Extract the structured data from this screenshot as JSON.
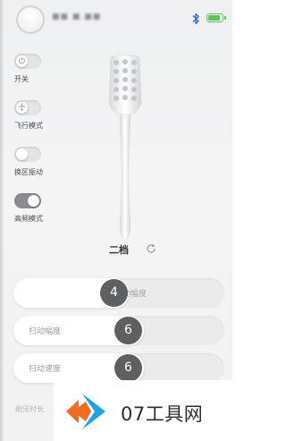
{
  "header": {
    "username": "■■ ■.■■",
    "bluetooth_icon": "bluetooth-icon",
    "battery_level": 0.9,
    "battery_color": "#5cc25a"
  },
  "toggles": [
    {
      "label": "开关",
      "state": false,
      "icon": "power-icon"
    },
    {
      "label": "飞行模式",
      "state": false,
      "icon": "airplane-icon"
    },
    {
      "label": "换区振动",
      "state": false,
      "icon": ""
    },
    {
      "label": "高频模式",
      "state": true,
      "icon": ""
    }
  ],
  "gear": {
    "label": "二档",
    "refresh_icon": "refresh-icon"
  },
  "sliders": [
    {
      "label": "扫动幅度",
      "value": "4",
      "fill_fraction": 0.55
    },
    {
      "label": "扫动幅度",
      "value": "6",
      "fill_fraction": 0.62
    },
    {
      "label": "扫动速度",
      "value": "6",
      "fill_fraction": 0.62
    }
  ],
  "bottom": {
    "duration_label": "刷牙时长"
  },
  "watermark": {
    "text": "07工具网",
    "colors": {
      "orange": "#f26b21",
      "blue": "#1aa4e8"
    }
  }
}
